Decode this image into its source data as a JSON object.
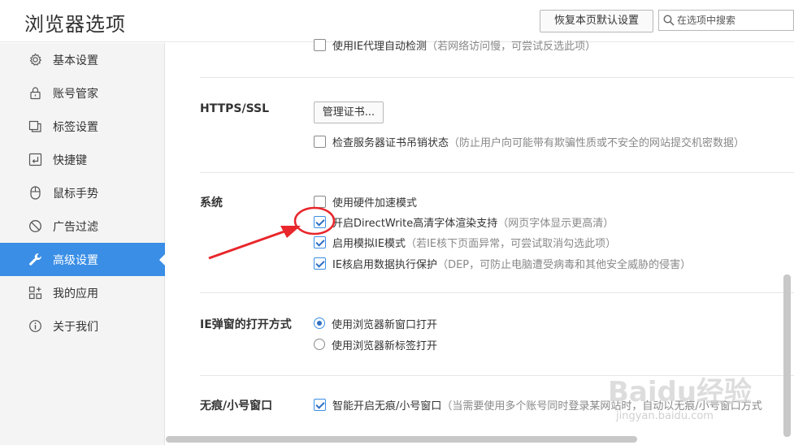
{
  "header": {
    "title": "浏览器选项",
    "reset_button": "恢复本页默认设置",
    "search_placeholder": "在选项中搜索"
  },
  "sidebar": {
    "items": [
      {
        "label": "基本设置",
        "icon": "gear-icon"
      },
      {
        "label": "账号管家",
        "icon": "lock-icon"
      },
      {
        "label": "标签设置",
        "icon": "tabs-icon"
      },
      {
        "label": "快捷键",
        "icon": "keyboard-icon"
      },
      {
        "label": "鼠标手势",
        "icon": "mouse-icon"
      },
      {
        "label": "广告过滤",
        "icon": "block-icon"
      },
      {
        "label": "高级设置",
        "icon": "wrench-icon",
        "active": true
      },
      {
        "label": "我的应用",
        "icon": "apps-icon"
      },
      {
        "label": "关于我们",
        "icon": "info-icon"
      }
    ]
  },
  "main": {
    "top_partial": {
      "label": "使用IE代理自动检测",
      "desc": "（若网络访问慢，可尝试反选此项）"
    },
    "https": {
      "title": "HTTPS/SSL",
      "cert_button": "管理证书...",
      "revocation": {
        "label": "检查服务器证书吊销状态",
        "desc": "（防止用户向可能带有欺骗性质或不安全的网站提交机密数据）",
        "checked": false
      }
    },
    "system": {
      "title": "系统",
      "options": [
        {
          "label": "使用硬件加速模式",
          "desc": "",
          "checked": false
        },
        {
          "label": "开启DirectWrite高清字体渲染支持",
          "desc": "（网页字体显示更高清）",
          "checked": true
        },
        {
          "label": "启用模拟IE模式",
          "desc": "（若IE核下页面异常，可尝试取消勾选此项）",
          "checked": true
        },
        {
          "label": "IE核启用数据执行保护",
          "desc": "（DEP，可防止电脑遭受病毒和其他安全威胁的侵害）",
          "checked": true
        }
      ]
    },
    "ie_popup": {
      "title": "IE弹窗的打开方式",
      "options": [
        {
          "label": "使用浏览器新窗口打开",
          "selected": true
        },
        {
          "label": "使用浏览器新标签打开",
          "selected": false
        }
      ]
    },
    "incognito": {
      "title": "无痕/小号窗口",
      "option": {
        "label": "智能开启无痕/小号窗口",
        "desc": "（当需要使用多个账号同时登录某网站时，自动以无痕/小号窗口方式",
        "checked": true
      }
    }
  },
  "watermark": {
    "text": "Baidu经验",
    "url": "jingyan.baidu.com"
  },
  "colors": {
    "accent": "#3a8ee6",
    "annotation_red": "#e8262b"
  }
}
